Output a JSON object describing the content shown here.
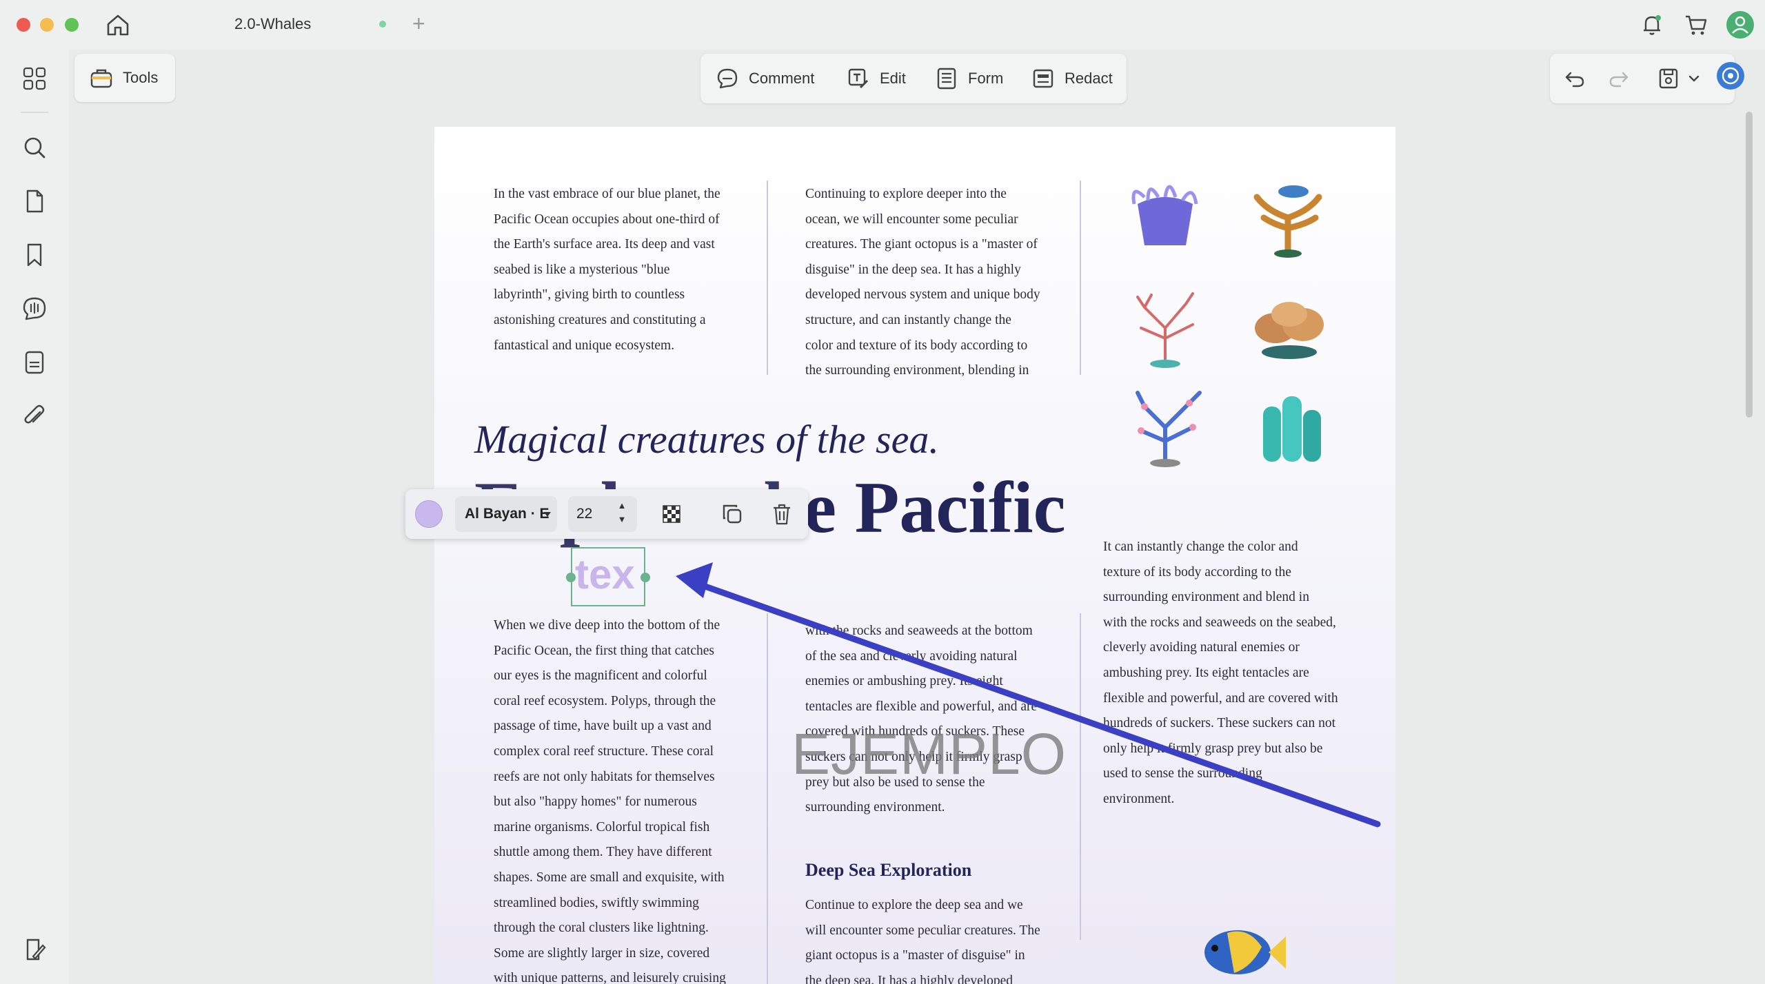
{
  "window": {
    "tab_title": "2.0-Whales",
    "new_tab_symbol": "+"
  },
  "toolbar": {
    "tools_label": "Tools",
    "modes": [
      {
        "label": "Comment",
        "icon": "comment-icon"
      },
      {
        "label": "Edit",
        "icon": "edit-text-icon"
      },
      {
        "label": "Form",
        "icon": "form-icon"
      },
      {
        "label": "Redact",
        "icon": "redact-icon"
      }
    ]
  },
  "text_edit_toolbar": {
    "font_family": "Al Bayan · E",
    "font_size": "22",
    "color": "#c9b8ee",
    "stepper_up": "▲",
    "stepper_down": "▼"
  },
  "selected_text_box": {
    "content": "tex"
  },
  "document": {
    "col1_top": [
      "In the vast embrace of our blue planet, the",
      "Pacific Ocean occupies about one-third of",
      "the Earth's surface area. Its deep and vast",
      "seabed is like a mysterious \"blue",
      "labyrinth\", giving birth to countless",
      "astonishing creatures and constituting a",
      "fantastical and unique ecosystem."
    ],
    "col2_top": [
      "Continuing to explore deeper into the",
      "ocean, we will encounter some peculiar",
      "creatures. The giant octopus is a \"master of",
      "disguise\" in the deep sea. It has a highly",
      "developed nervous system and unique body",
      "structure, and can instantly change the",
      "color and texture of its body according to",
      "the surrounding environment, blending in"
    ],
    "headline_italic": "Magical creatures of the sea.",
    "headline_big": "e Pacific",
    "col3_mid": [
      "It can instantly change the color and",
      "texture of its body according to the",
      "surrounding environment and blend in",
      "with the rocks and seaweeds on the seabed,",
      "cleverly avoiding natural enemies or",
      "ambushing prey. Its eight tentacles are",
      "flexible and powerful, and are covered with",
      "hundreds of suckers. These suckers can not",
      "only help it firmly grasp prey but also be",
      "used to sense the surrounding",
      "environment."
    ],
    "col1_bottom": [
      "When we dive deep into the bottom of the",
      "Pacific Ocean, the first thing that catches",
      "our eyes is the magnificent and colorful",
      "coral reef ecosystem. Polyps, through the",
      "passage of time, have built up a vast and",
      "complex coral reef structure. These coral",
      "reefs are not only habitats for themselves",
      "but also \"happy homes\" for numerous",
      "marine organisms. Colorful tropical fish",
      "shuttle among them. They have different",
      "shapes. Some are small and exquisite, with",
      "streamlined bodies, swiftly swimming",
      "through the coral clusters like lightning.",
      "Some are slightly larger in size, covered",
      "with unique patterns, and leisurely cruising"
    ],
    "col2_bottom": [
      "with the rocks and seaweeds at the bottom",
      "of the sea and cleverly avoiding natural",
      "enemies or ambushing prey. Its eight",
      "tentacles are flexible and powerful, and are",
      "covered with hundreds of suckers. These",
      "suckers can not only help it firmly grasp",
      "prey but also be used to sense the",
      "surrounding environment."
    ],
    "subheading": "Deep Sea Exploration",
    "col2_deep": [
      "Continue to explore the deep sea and we",
      "will encounter some peculiar creatures. The",
      "giant octopus is a \"master of disguise\" in",
      "the deep sea. It has a highly developed"
    ],
    "watermark": "EJEMPLO"
  },
  "colors": {
    "arrow": "#3a3fc4",
    "heading": "#23245a",
    "selection": "#6ab38e"
  }
}
